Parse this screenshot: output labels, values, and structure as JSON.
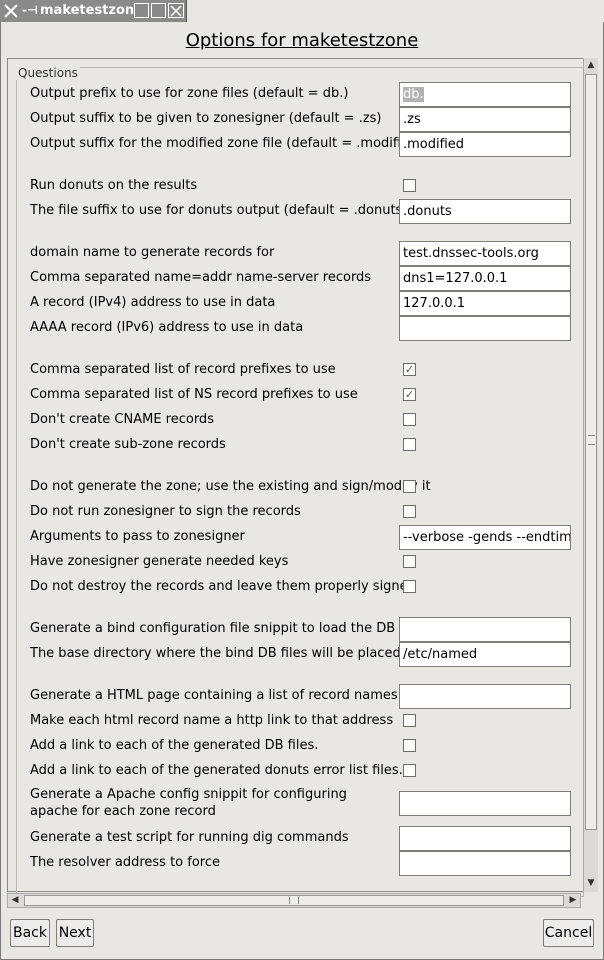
{
  "window": {
    "title": "maketestzone"
  },
  "heading": "Options for maketestzone",
  "section_label": "Questions",
  "rows": [
    {
      "label": "Output prefix to use for zone files (default = db.)",
      "type": "entry",
      "value": "db.",
      "selected": true
    },
    {
      "label": "Output suffix to be given to zonesigner (default = .zs)",
      "type": "entry",
      "value": ".zs"
    },
    {
      "label": "Output suffix for the modified zone file (default = .modified)",
      "type": "entry",
      "value": ".modified"
    },
    {
      "label": "Run donuts on the results",
      "type": "check",
      "checked": false
    },
    {
      "label": "The file suffix to use for donuts output (default = .donuts)",
      "type": "entry",
      "value": ".donuts"
    },
    {
      "label": "domain name to generate records for",
      "type": "entry",
      "value": "test.dnssec-tools.org"
    },
    {
      "label": "Comma separated name=addr name-server records",
      "type": "entry",
      "value": "dns1=127.0.0.1"
    },
    {
      "label": "A record (IPv4) address to use in data",
      "type": "entry",
      "value": "127.0.0.1"
    },
    {
      "label": "AAAA record (IPv6) address to use in data",
      "type": "entry",
      "value": ""
    },
    {
      "label": "Comma separated list of record prefixes to use",
      "type": "check",
      "checked": true
    },
    {
      "label": "Comma separated list of NS record prefixes to use",
      "type": "check",
      "checked": true
    },
    {
      "label": "Don't create CNAME records",
      "type": "check",
      "checked": false
    },
    {
      "label": "Don't create sub-zone records",
      "type": "check",
      "checked": false
    },
    {
      "label": "Do not generate the zone; use the existing and sign/modify it",
      "type": "check",
      "checked": false
    },
    {
      "label": "Do not run zonesigner to sign the records",
      "type": "check",
      "checked": false
    },
    {
      "label": "Arguments to pass to zonesigner",
      "type": "entry",
      "value": "--verbose -gends --endtime +"
    },
    {
      "label": "Have zonesigner generate needed keys",
      "type": "check",
      "checked": false
    },
    {
      "label": "Do not destroy the records and leave them properly signed",
      "type": "check",
      "checked": false
    },
    {
      "label": "Generate a bind configuration file snippit to load the DB sets",
      "type": "entry",
      "value": ""
    },
    {
      "label": "The base directory where the bind DB files will be placed",
      "type": "entry",
      "value": "/etc/named"
    },
    {
      "label": "Generate a HTML page containing a list of record names",
      "type": "entry",
      "value": ""
    },
    {
      "label": "Make each html record name a http link to that address",
      "type": "check",
      "checked": false
    },
    {
      "label": "Add a link to each of the generated DB files.",
      "type": "check",
      "checked": false
    },
    {
      "label": "Add a link to each of the generated donuts error list files.",
      "type": "check",
      "checked": false
    },
    {
      "label": "Generate a Apache config snippit for configuring apache for each zone record",
      "type": "entry",
      "value": ""
    },
    {
      "label": "Generate a test script for running dig commands",
      "type": "entry",
      "value": ""
    },
    {
      "label": "The resolver address to force",
      "type": "entry",
      "value": ""
    }
  ],
  "buttons": {
    "back": "Back",
    "next": "Next",
    "cancel": "Cancel"
  },
  "icons": {
    "check_glyph": "✓",
    "pin": "-⊣"
  }
}
